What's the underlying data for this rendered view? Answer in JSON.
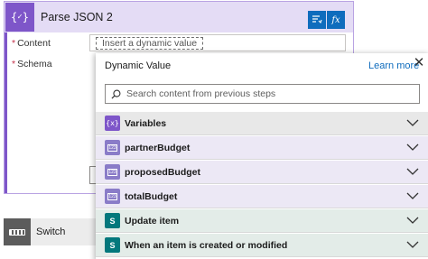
{
  "card": {
    "title": "Parse JSON 2",
    "icon": "braces-variable-icon",
    "accent": "#7e56c9",
    "header_bg": "#e4dcf5",
    "fields": [
      {
        "label": "Content",
        "required": "*",
        "placeholder": "Insert a dynamic value"
      },
      {
        "label": "Schema",
        "required": "*"
      }
    ],
    "dynamic_content_icon": "dynamic-content-icon",
    "expression_label": "fx"
  },
  "switch": {
    "label": "Switch",
    "icon": "switch-icon"
  },
  "panel": {
    "title": "Dynamic Value",
    "learn_more": "Learn more",
    "close_icon": "close-icon",
    "search_placeholder": "Search content from previous steps",
    "rows": [
      {
        "label": "Variables",
        "icon": "variables-icon",
        "icon_text": "{x}",
        "icon_color": "#7e56c9"
      },
      {
        "label": "partnerBudget",
        "icon": "variable-type-icon",
        "icon_text": "123",
        "icon_color": "#8a7cc8"
      },
      {
        "label": "proposedBudget",
        "icon": "variable-type-icon",
        "icon_text": "123",
        "icon_color": "#8a7cc8"
      },
      {
        "label": "totalBudget",
        "icon": "variable-type-icon",
        "icon_text": "123",
        "icon_color": "#8a7cc8"
      },
      {
        "label": "Update item",
        "icon": "sharepoint-icon",
        "icon_text": "S",
        "icon_color": "#03787c"
      },
      {
        "label": "When an item is created or modified",
        "icon": "sharepoint-icon",
        "icon_text": "S",
        "icon_color": "#03787c"
      }
    ]
  }
}
